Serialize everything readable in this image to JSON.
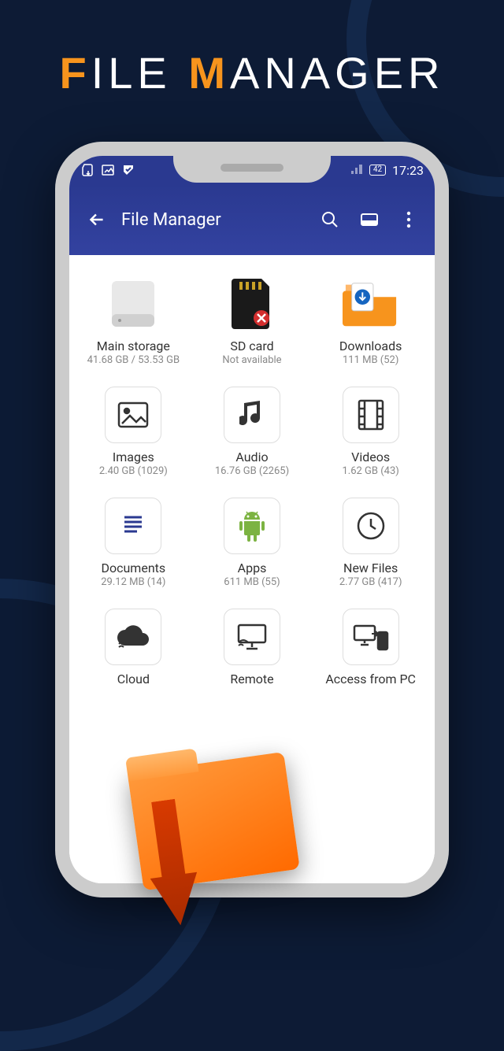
{
  "headline": {
    "letter1": "F",
    "word1_rest": "ILE ",
    "letter2": "M",
    "word2_rest": "ANAGER"
  },
  "status": {
    "battery_level": "42",
    "time": "17:23"
  },
  "appbar": {
    "title": "File Manager"
  },
  "tiles": {
    "main_storage": {
      "label": "Main storage",
      "sub": "41.68 GB / 53.53 GB"
    },
    "sd_card": {
      "label": "SD card",
      "sub": "Not available"
    },
    "downloads": {
      "label": "Downloads",
      "sub": "111 MB (52)"
    },
    "images": {
      "label": "Images",
      "sub": "2.40 GB (1029)"
    },
    "audio": {
      "label": "Audio",
      "sub": "16.76 GB (2265)"
    },
    "videos": {
      "label": "Videos",
      "sub": "1.62 GB (43)"
    },
    "documents": {
      "label": "Documents",
      "sub": "29.12 MB (14)"
    },
    "apps": {
      "label": "Apps",
      "sub": "611 MB (55)"
    },
    "new_files": {
      "label": "New Files",
      "sub": "2.77 GB (417)"
    },
    "cloud": {
      "label": "Cloud",
      "sub": ""
    },
    "remote": {
      "label": "Remote",
      "sub": ""
    },
    "access_pc": {
      "label": "Access from PC",
      "sub": ""
    }
  }
}
